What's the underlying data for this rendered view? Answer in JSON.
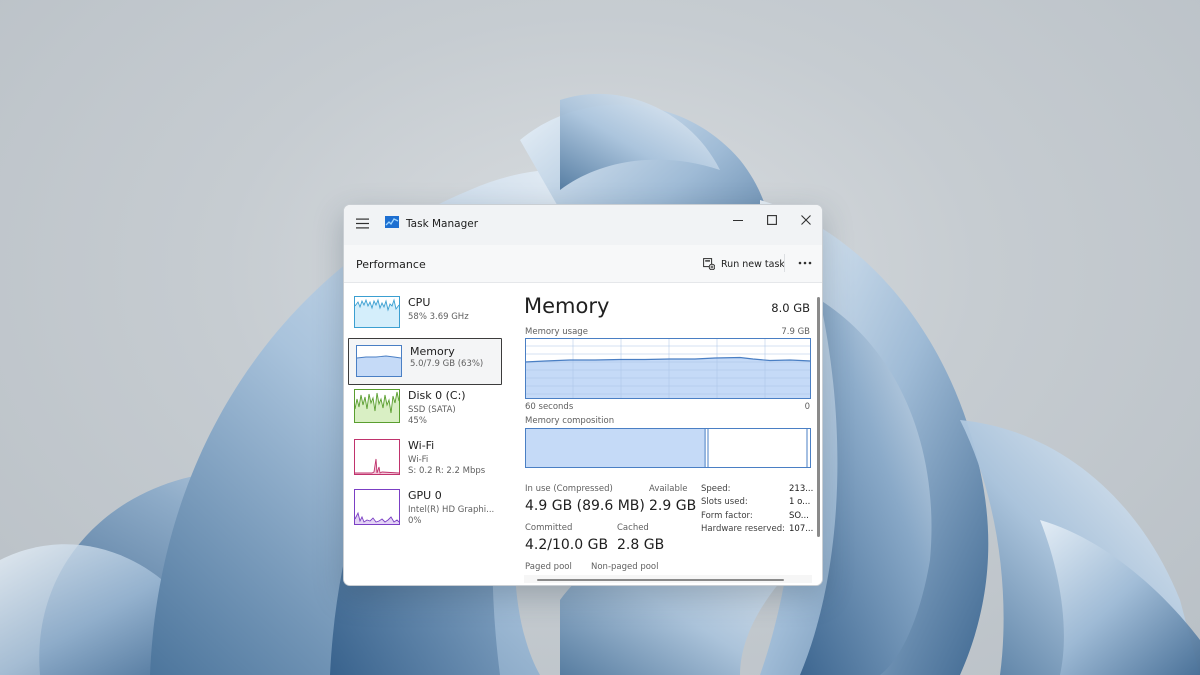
{
  "window": {
    "title": "Task Manager"
  },
  "header": {
    "page_title": "Performance",
    "run_new_task": "Run new task"
  },
  "sidebar": {
    "items": [
      {
        "name": "CPU",
        "line1": "58% 3.69 GHz",
        "line2": ""
      },
      {
        "name": "Memory",
        "line1": "5.0/7.9 GB (63%)",
        "line2": ""
      },
      {
        "name": "Disk 0 (C:)",
        "line1": "SSD (SATA)",
        "line2": "45%"
      },
      {
        "name": "Wi-Fi",
        "line1": "Wi-Fi",
        "line2": "S: 0.2  R: 2.2 Mbps"
      },
      {
        "name": "GPU 0",
        "line1": "Intel(R) HD Graphi...",
        "line2": "0%"
      }
    ]
  },
  "memory": {
    "title": "Memory",
    "total": "8.0 GB",
    "usage_label": "Memory usage",
    "usage_max": "7.9 GB",
    "time_left": "60 seconds",
    "time_right": "0",
    "composition_label": "Memory composition",
    "in_use_fraction": 0.63,
    "stats": {
      "in_use_label": "In use (Compressed)",
      "in_use_value": "4.9 GB (89.6 MB)",
      "available_label": "Available",
      "available_value": "2.9 GB",
      "committed_label": "Committed",
      "committed_value": "4.2/10.0 GB",
      "cached_label": "Cached",
      "cached_value": "2.8 GB",
      "paged_pool_label": "Paged pool",
      "non_paged_pool_label": "Non-paged pool"
    },
    "details": [
      {
        "label": "Speed:",
        "value": "213..."
      },
      {
        "label": "Slots used:",
        "value": "1 o..."
      },
      {
        "label": "Form factor:",
        "value": "SO..."
      },
      {
        "label": "Hardware reserved:",
        "value": "107..."
      }
    ]
  },
  "colors": {
    "memory_stroke": "#4a7fc4",
    "memory_fill": "#c5daf7",
    "cpu_stroke": "#3b9fd1",
    "cpu_fill": "#d4eefb",
    "disk_stroke": "#5a9e2f",
    "disk_fill": "#d9efc4",
    "wifi_stroke": "#c0336d",
    "gpu_stroke": "#7b3fc4"
  },
  "icons": {
    "menu": "hamburger-icon",
    "app": "task-manager-icon",
    "run": "run-task-icon",
    "more": "more-icon"
  }
}
